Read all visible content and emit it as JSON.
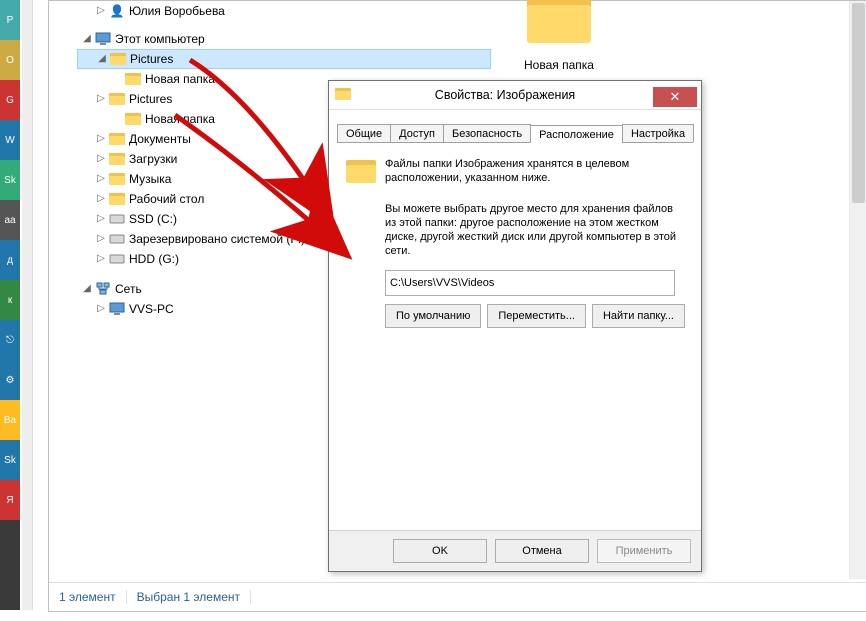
{
  "desktop_folder": {
    "label": "Новая папка"
  },
  "tree": {
    "user_item": "Юлия Воробьева",
    "computer": "Этот компьютер",
    "pictures1": "Pictures",
    "pictures1_sub": "Новая папка",
    "pictures2": "Pictures",
    "pictures2_sub": "Новая папка",
    "documents": "Документы",
    "downloads": "Загрузки",
    "music": "Музыка",
    "desktop": "Рабочий стол",
    "ssd": "SSD (C:)",
    "reserved": "Зарезервировано системой (F:)",
    "hdd": "HDD (G:)",
    "network": "Сеть",
    "vvs_pc": "VVS-PC"
  },
  "statusbar": {
    "count": "1 элемент",
    "selection": "Выбран 1 элемент"
  },
  "dialog": {
    "title": "Свойства: Изображения",
    "tabs": {
      "general": "Общие",
      "access": "Доступ",
      "security": "Безопасность",
      "location": "Расположение",
      "customize": "Настройка"
    },
    "line1": "Файлы папки Изображения хранятся в целевом расположении, указанном ниже.",
    "line2": "Вы можете выбрать другое место для хранения файлов из этой папки: другое расположение на этом жестком диске, другой жесткий диск или другой компьютер в этой сети.",
    "path": "C:\\Users\\VVS\\Videos",
    "btn_default": "По умолчанию",
    "btn_move": "Переместить...",
    "btn_find": "Найти папку...",
    "ok": "OK",
    "cancel": "Отмена",
    "apply": "Применить"
  },
  "accent": {
    "arrow": "#d10a0a"
  }
}
